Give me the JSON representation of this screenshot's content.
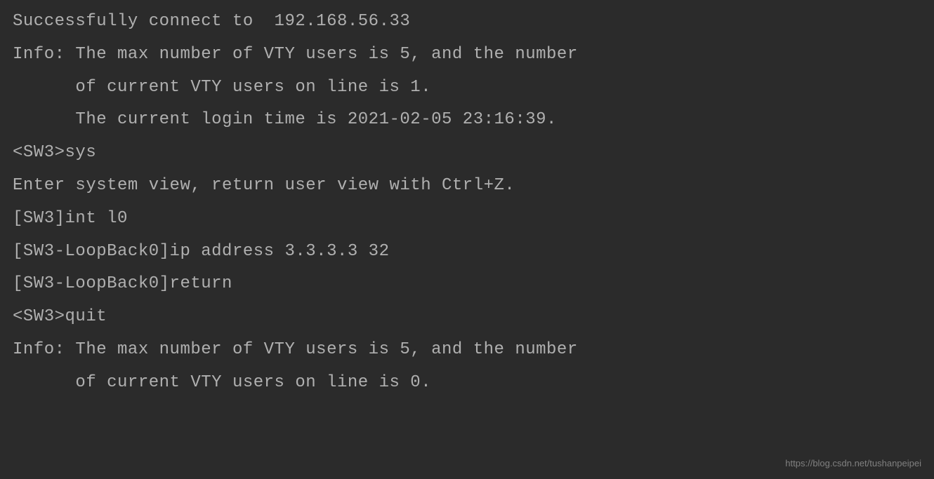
{
  "terminal": {
    "lines": [
      "Successfully connect to  192.168.56.33",
      "",
      "Info: The max number of VTY users is 5, and the number",
      "      of current VTY users on line is 1.",
      "      The current login time is 2021-02-05 23:16:39.",
      "<SW3>sys",
      "Enter system view, return user view with Ctrl+Z.",
      "[SW3]int l0",
      "[SW3-LoopBack0]ip address 3.3.3.3 32",
      "[SW3-LoopBack0]return",
      "<SW3>quit",
      "Info: The max number of VTY users is 5, and the number",
      "      of current VTY users on line is 0."
    ]
  },
  "watermark": {
    "text": "https://blog.csdn.net/tushanpeipei"
  }
}
